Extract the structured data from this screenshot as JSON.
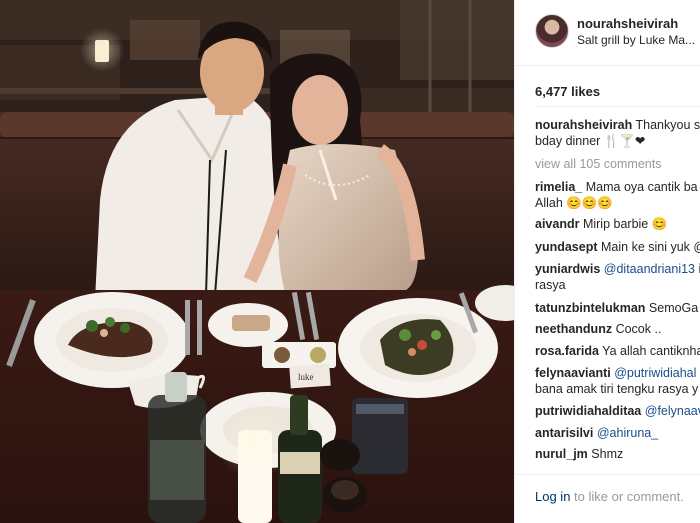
{
  "post": {
    "username": "nourahsheivirah",
    "location": "Salt grill by Luke Ma...",
    "likes": "6,477 likes",
    "caption_user": "nourahsheivirah",
    "caption_text_1": "Thankyou s",
    "caption_text_2": "bday dinner 🍴🍸❤",
    "view_all": "view all 105 comments",
    "menu_logo_text": "luke"
  },
  "comments": [
    {
      "user": "rimelia_",
      "line1": "Mama oya cantik ba",
      "line2": "Allah 😊😊😊"
    },
    {
      "user": "aivandr",
      "line1": "Mirip barbie 😊"
    },
    {
      "user": "yundasept",
      "line1": "Main ke sini yuk @"
    },
    {
      "user": "yuniardwis",
      "mention": "@ditaandriani13",
      "line1": " il",
      "line2": "rasya"
    },
    {
      "user": "tatunzbintelukman",
      "line1": "SemoGa"
    },
    {
      "user": "neethandunz",
      "line1": "Cocok .."
    },
    {
      "user": "rosa.farida",
      "line1": "Ya allah cantiknha"
    },
    {
      "user": "felynaavianti",
      "mention": "@putriwidiahal",
      "line2": "bana amak tiri tengku rasya y"
    },
    {
      "user": "putriwidiahalditaa",
      "mention": "@felynaav"
    },
    {
      "user": "antarisilvi",
      "mention": "@ahiruna_"
    },
    {
      "user": "nurul_jm",
      "line1": "Shmz"
    }
  ],
  "footer": {
    "login_link": "Log in",
    "login_rest": " to like or comment."
  },
  "colors": {
    "link": "#003569",
    "mention": "#1a4e8a",
    "muted": "#999999",
    "text": "#262626"
  }
}
